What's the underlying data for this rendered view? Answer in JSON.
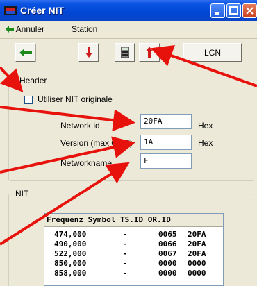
{
  "window": {
    "title": "Créer NIT"
  },
  "menu": {
    "back_label": "Annuler",
    "station_label": "Station"
  },
  "toolbar": {
    "lcn_label": "LCN"
  },
  "header_group": {
    "legend": "Header",
    "use_original_label": "Utiliser NIT originale",
    "use_original_checked": false,
    "network_id_label": "Network id",
    "network_id_value": "20FA",
    "network_id_unit": "Hex",
    "version_label": "Version (max 0x1F)",
    "version_value": "1A",
    "version_unit": "Hex",
    "networkname_label": "Networkname",
    "networkname_value": "F"
  },
  "nit_group": {
    "legend": "NIT",
    "columns": [
      "Frequenz",
      "Symbol",
      "TS.ID",
      "OR.ID"
    ],
    "rows": [
      {
        "freq": "474,000",
        "symbol": "-",
        "tsid": "0065",
        "orid": "20FA"
      },
      {
        "freq": "490,000",
        "symbol": "-",
        "tsid": "0066",
        "orid": "20FA"
      },
      {
        "freq": "522,000",
        "symbol": "-",
        "tsid": "0067",
        "orid": "20FA"
      },
      {
        "freq": "850,000",
        "symbol": "-",
        "tsid": "0000",
        "orid": "0000"
      },
      {
        "freq": "858,000",
        "symbol": "-",
        "tsid": "0000",
        "orid": "0000"
      }
    ]
  },
  "colors": {
    "title_blue": "#0046d5",
    "annotation_red": "#e8120c",
    "icon_green": "#1b8a1b"
  }
}
